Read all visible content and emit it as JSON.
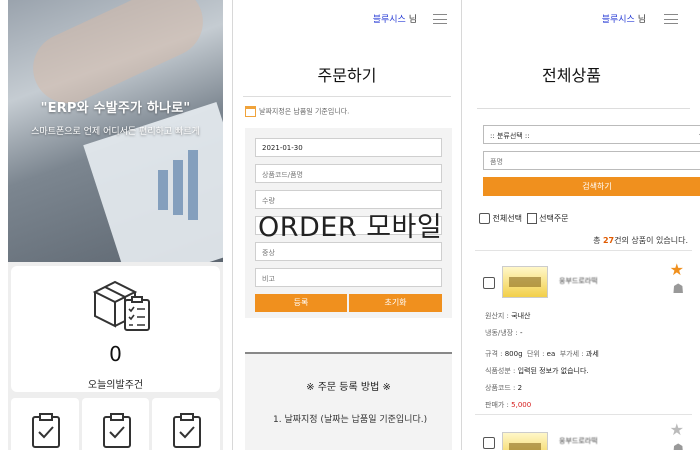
{
  "panel1": {
    "hero_title": "\"ERP와 수발주가 하나로\"",
    "hero_subtitle": "스마트폰으로 언제 어디서든 편리하고 빠르게",
    "order_count": "0",
    "order_count_label": "오늘의발주건"
  },
  "panel2": {
    "user_name": "블루시스",
    "user_suffix": "님",
    "title": "주문하기",
    "date_note": "날짜지정은 납품일 기준입니다.",
    "fields": {
      "date_value": "2021-01-30",
      "product_placeholder": "상품코드/품명",
      "qty_placeholder": "수량",
      "field4_placeholder": "",
      "weight_placeholder": "중상",
      "memo_placeholder": "비고"
    },
    "register_label": "등록",
    "reset_label": "초기화",
    "watermark": "ORDER 모바일",
    "howto_title": "※ 주문 등록 방법 ※",
    "howto_step1": "1. 날짜지정 (날짜는 납품일 기준입니다.)"
  },
  "panel3": {
    "user_name": "블루시스",
    "user_suffix": "님",
    "title": "전체상품",
    "category_select": ":: 분류선택 ::",
    "search_placeholder": "품명",
    "search_label": "검색하기",
    "select_all_label": "전체선택",
    "selected_order_label": "선택주문",
    "total_prefix": "총",
    "total_count": "27",
    "total_suffix": "건의 상품이 있습니다.",
    "products": [
      {
        "name": "웅부드로라떡",
        "origin_label": "원산지 :",
        "origin": "국내산",
        "storage_label": "냉동/냉장 :",
        "storage": "-",
        "spec_label": "규격 :",
        "spec": "800g",
        "unit_label": "단위 :",
        "unit": "ea",
        "tax_label": "부가세 :",
        "tax": "과세",
        "allergy_label": "식품성분 :",
        "allergy": "입력된 정보가 없습니다.",
        "code_label": "상품코드 :",
        "code": "2",
        "price_label": "판매가 :",
        "price": "5,000",
        "favorite": true
      },
      {
        "name": "웅부드로라떡",
        "favorite": false
      }
    ]
  },
  "colors": {
    "accent": "#f0901e",
    "user": "#2b3fd6",
    "star_on": "#f0901e",
    "star_off": "#bbbbbb",
    "price": "#d61c1c"
  }
}
